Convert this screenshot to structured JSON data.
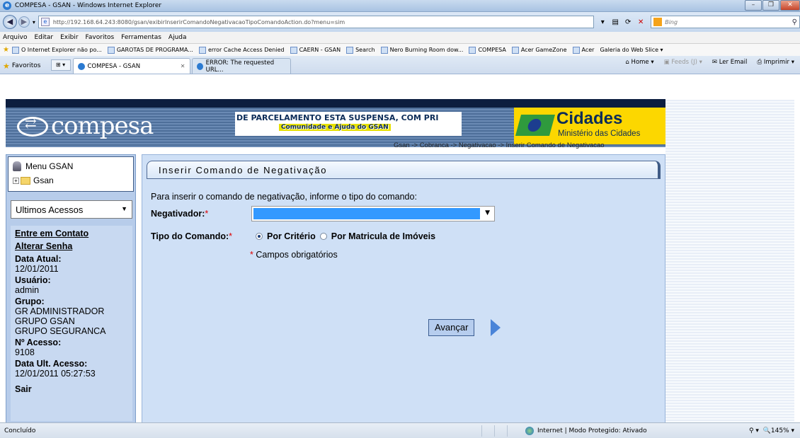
{
  "window": {
    "title": "COMPESA - GSAN - Windows Internet Explorer",
    "address_url": "http://192.168.64.243:8080/gsan/exibirInserirComandoNegativacaoTipoComandoAction.do?menu=sim",
    "search_placeholder": "Bing"
  },
  "menubar": [
    "Arquivo",
    "Editar",
    "Exibir",
    "Favoritos",
    "Ferramentas",
    "Ajuda"
  ],
  "links": [
    "O Internet Explorer não po...",
    "GAROTAS DE PROGRAMA...",
    "error Cache Access Denied",
    "CAERN - GSAN",
    "Search",
    "Nero Burning Room dow...",
    "COMPESA",
    "Acer GameZone",
    "Acer",
    "Galeria do Web Slice ▾"
  ],
  "tabs": {
    "favorites": "Favoritos",
    "active": "COMPESA - GSAN",
    "other": "ERROR: The requested URL..."
  },
  "commandbar": {
    "home": "Home",
    "feeds": "Feeds (J)",
    "email": "Ler Email",
    "print": "Imprimir"
  },
  "header": {
    "logo": "compesa",
    "marquee": "DE PARCELAMENTO ESTA SUSPENSA, COM PRI",
    "help": "Comunidade e Ajuda do GSAN",
    "cidades": "Cidades",
    "ministerio": "Ministério das Cidades",
    "breadcrumb": "Gsan -> Cobranca -> Negativacao -> Inserir Comando de Negativacao"
  },
  "sidebar": {
    "menu_root": "Menu GSAN",
    "menu_node": "Gsan",
    "ultimos": "Ultimos Acessos",
    "contato": "Entre em Contato",
    "senha": "Alterar Senha",
    "data_atual_label": "Data Atual:",
    "data_atual": "12/01/2011",
    "usuario_label": "Usuário:",
    "usuario": "admin",
    "grupo_label": "Grupo:",
    "grupos": [
      "GR ADMINISTRADOR",
      "GRUPO GSAN",
      "GRUPO SEGURANCA"
    ],
    "acesso_label": "Nº Acesso:",
    "acesso": "9108",
    "ult_acesso_label": "Data Ult. Acesso:",
    "ult_acesso": "12/01/2011 05:27:53",
    "sair": "Sair"
  },
  "form": {
    "title": "Inserir Comando de Negativação",
    "intro": "Para inserir o comando de negativação, informe o tipo do comando:",
    "negativador_label": "Negativador:",
    "tipo_label": "Tipo do Comando:",
    "option_criterio": "Por Critério",
    "option_matricula": "Por Matricula de Imóveis",
    "required_mark": "*",
    "required_note": "Campos obrigatórios",
    "next_button": "Avançar"
  },
  "status": {
    "text": "Concluído",
    "zone": "Internet | Modo Protegido: Ativado",
    "zoom": "145%"
  }
}
